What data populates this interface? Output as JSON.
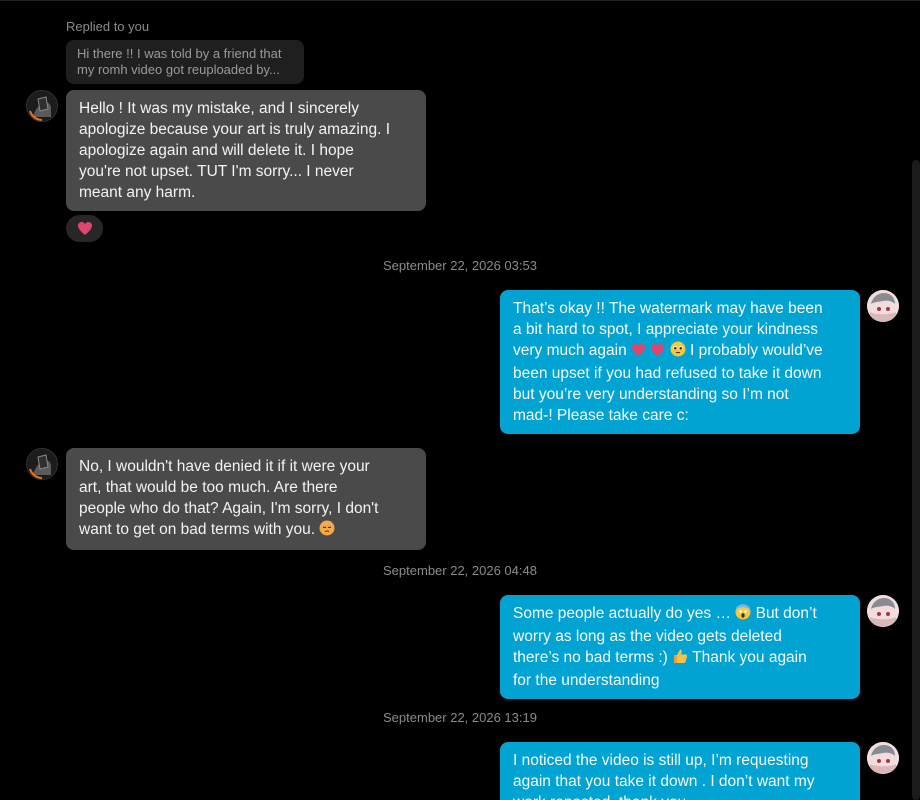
{
  "reply_context": {
    "label": "Replied to you",
    "quoted": "Hi there !! I was told by a friend that\nmy romh video got reuploaded by..."
  },
  "messages": [
    {
      "side": "in",
      "text": "Hello ! It was my mistake, and I sincerely\napologize because your art is truly amazing. I\napologize again and will delete it. I hope\nyou're not upset. TUT I'm sorry... I never\nmeant any harm.",
      "reaction": "heart"
    },
    {
      "timestamp": "September 22, 2026 03:53"
    },
    {
      "side": "out",
      "text_a": "That’s okay !! The watermark may have been\na bit hard to spot, I appreciate your kindness\nvery much again ",
      "text_b": " I probably would’ve\nbeen upset if you had refused to take it down\nbut you’re very understanding so I’m not\nmad-! Please take care c:"
    },
    {
      "side": "in",
      "text_a": "No, I wouldn't have denied it if it were your\nart, that would be too much. Are there\npeople who do that? Again, I'm sorry, I don't\nwant to get on bad terms with you.  "
    },
    {
      "timestamp": "September 22, 2026 04:48"
    },
    {
      "side": "out",
      "text_a": "Some people actually do yes … ",
      "text_b": " But don’t\nworry as long as the video gets deleted\nthere’s no bad terms :) ",
      "text_c": "  Thank you again\nfor the understanding"
    },
    {
      "timestamp": "September 22, 2026 13:19"
    },
    {
      "side": "out",
      "text": "I noticed the video is still up, I’m requesting\nagain that you take it down . I don’t want my\nwork reposted, thank you"
    }
  ],
  "icons": [
    "heart-emoji",
    "pleading-face-emoji",
    "screaming-face-emoji",
    "thumbs-up-emoji",
    "pensive-face-emoji"
  ],
  "colors": {
    "outgoing_bubble": "#00a3d1",
    "incoming_bubble": "#4a4a4a",
    "background": "#000000"
  }
}
